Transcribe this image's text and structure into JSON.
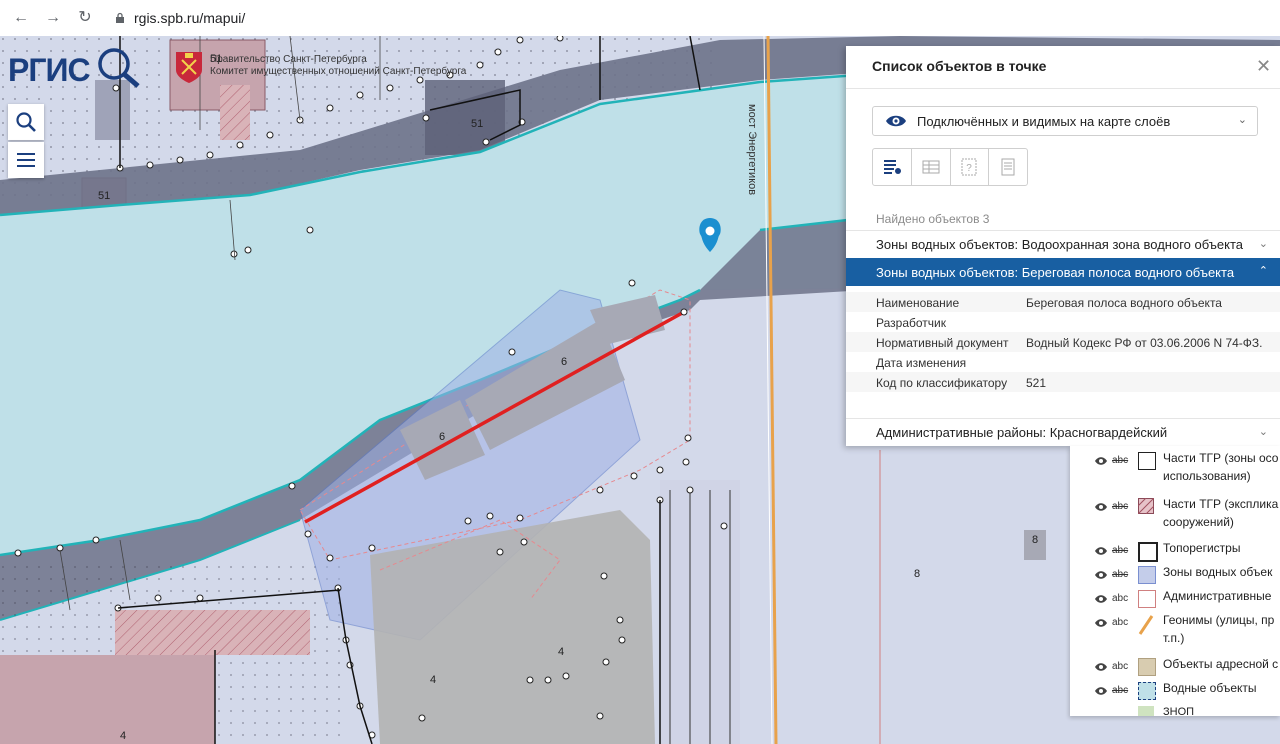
{
  "browser": {
    "url": "rgis.spb.ru/mapui/"
  },
  "logo": {
    "text": "РГИС"
  },
  "gov": {
    "line1": "Правительство Санкт-Петербурга",
    "line2": "Комитет имущественных отношений Санкт-Петербурга"
  },
  "map_labels": {
    "bridge": "мост Энергетиков",
    "n51a": "51",
    "n51b": "51",
    "n51c": "51",
    "n6a": "6",
    "n6b": "6",
    "n4a": "4",
    "n4b": "4",
    "n4c": "4",
    "n8a": "8",
    "n8b": "8"
  },
  "panel": {
    "title": "Список объектов в точке",
    "select_label": "Подключённых и видимых на карте слоёв",
    "found": "Найдено объектов 3",
    "items": [
      {
        "label": "Зоны водных объектов: Водоохранная зона водного объекта"
      },
      {
        "label": "Зоны водных объектов: Береговая полоса водного объекта"
      },
      {
        "label": "Административные районы: Красногвардейский"
      }
    ],
    "props": [
      {
        "k": "Наименование",
        "v": "Береговая полоса водного объекта"
      },
      {
        "k": "Разработчик",
        "v": ""
      },
      {
        "k": "Нормативный документ",
        "v": "Водный Кодекс РФ от 03.06.2006 N 74-ФЗ."
      },
      {
        "k": "Дата изменения",
        "v": ""
      },
      {
        "k": "Код по классификатору",
        "v": "521"
      }
    ]
  },
  "legend": {
    "items": [
      {
        "line1": "Части ТГР (зоны осо",
        "line2": "использования)",
        "abc": "abc",
        "abc_strike": true,
        "swatch": "box-white"
      },
      {
        "line1": "Части ТГР (эксплика",
        "line2": "сооружений)",
        "abc": "abc",
        "abc_strike": true,
        "swatch": "hatch-red"
      },
      {
        "line1": "Топорегистры",
        "line2": "",
        "abc": "abc",
        "abc_strike": true,
        "swatch": "box-dark"
      },
      {
        "line1": "Зоны водных объек",
        "line2": "",
        "abc": "abc",
        "abc_strike": true,
        "swatch": "box-blue"
      },
      {
        "line1": "Административные",
        "line2": "",
        "abc": "abc",
        "abc_strike": false,
        "swatch": "box-pink"
      },
      {
        "line1": "Геонимы (улицы, пр",
        "line2": "т.п.)",
        "abc": "abc",
        "abc_strike": false,
        "swatch": "line-orange"
      },
      {
        "line1": "Объекты адресной с",
        "line2": "",
        "abc": "abc",
        "abc_strike": false,
        "swatch": "box-tan"
      },
      {
        "line1": "Водные объекты",
        "line2": "",
        "abc": "abc",
        "abc_strike": true,
        "swatch": "box-water"
      },
      {
        "line1": "ЗНОП",
        "line2": "",
        "abc": "",
        "abc_strike": false,
        "swatch": "box-green"
      }
    ]
  },
  "colors": {
    "water": "#bfe0e8",
    "shore": "#6e7287",
    "zone": "#c4cdea",
    "building": "#b3b3b3",
    "accent": "#185fa2",
    "red_line": "#e02020"
  }
}
